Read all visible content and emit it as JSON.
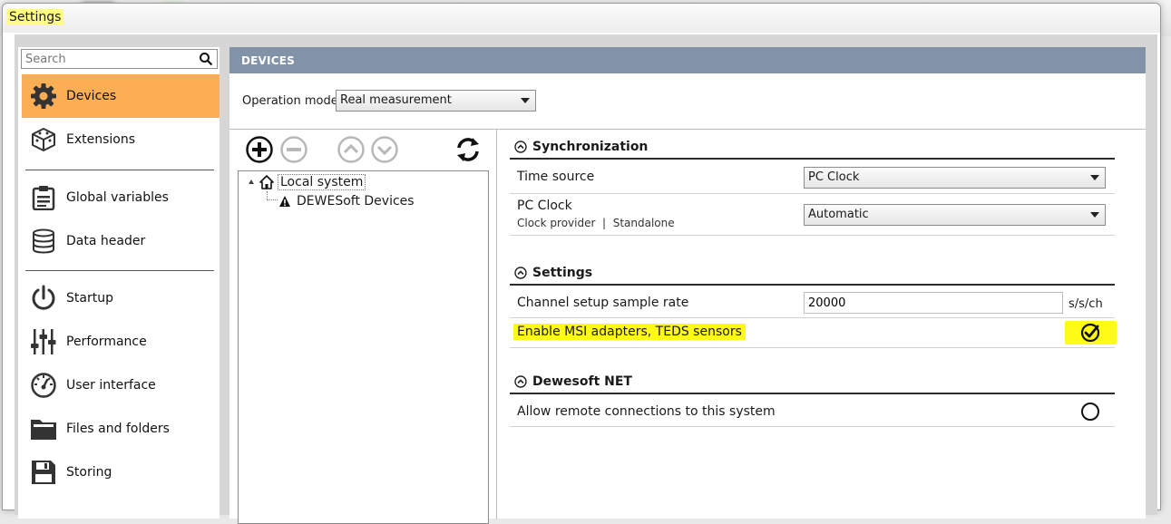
{
  "window": {
    "title": "Settings"
  },
  "sidebar": {
    "search_placeholder": "Search",
    "items": [
      {
        "label": "Devices",
        "icon": "gear-icon",
        "active": true
      },
      {
        "label": "Extensions",
        "icon": "cube-icon"
      },
      {
        "label": "Global variables",
        "icon": "clipboard-icon"
      },
      {
        "label": "Data header",
        "icon": "database-icon"
      },
      {
        "label": "Startup",
        "icon": "power-icon"
      },
      {
        "label": "Performance",
        "icon": "sliders-icon"
      },
      {
        "label": "User interface",
        "icon": "gauge-icon"
      },
      {
        "label": "Files and folders",
        "icon": "folder-icon"
      },
      {
        "label": "Storing",
        "icon": "floppy-disk-icon"
      }
    ]
  },
  "main": {
    "header": "DEVICES",
    "operation_mode_label": "Operation mode",
    "operation_mode_value": "Real measurement"
  },
  "tree": {
    "root": "Local system",
    "child": "DEWESoft Devices"
  },
  "sections": {
    "synchronization": {
      "title": "Synchronization",
      "time_source_label": "Time source",
      "time_source_value": "PC Clock",
      "pc_clock_label": "PC Clock",
      "pc_clock_sub": "Clock provider  |  Standalone",
      "pc_clock_value": "Automatic"
    },
    "settings": {
      "title": "Settings",
      "sample_rate_label": "Channel setup sample rate",
      "sample_rate_value": "20000",
      "sample_rate_unit": "s/s/ch",
      "msi_label": "Enable MSI adapters, TEDS sensors",
      "msi_checked": true
    },
    "net": {
      "title": "Dewesoft NET",
      "remote_label": "Allow remote connections to this system",
      "remote_checked": false
    }
  },
  "colors": {
    "active_nav": "#fcae55",
    "header_bar": "#8393a7",
    "highlight": "#fffb16"
  }
}
